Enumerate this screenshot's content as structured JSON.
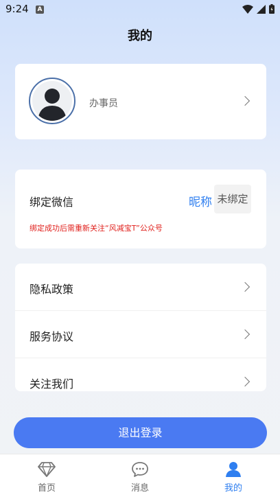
{
  "status_bar": {
    "time": "9:24",
    "notif_icon": "A"
  },
  "page": {
    "title": "我的"
  },
  "profile": {
    "name": "办事员"
  },
  "wechat": {
    "label": "绑定微信",
    "nickname": "昵称",
    "status": "未绑定",
    "notice": "绑定成功后需重新关注“风减宝T”公众号"
  },
  "menu": {
    "items": [
      {
        "label": "隐私政策"
      },
      {
        "label": "服务协议"
      },
      {
        "label": "关注我们"
      }
    ]
  },
  "logout_label": "退出登录",
  "tabbar": {
    "tabs": [
      {
        "label": "首页",
        "icon": "diamond-icon"
      },
      {
        "label": "消息",
        "icon": "chat-bubble-icon"
      },
      {
        "label": "我的",
        "icon": "person-icon"
      }
    ],
    "active_index": 2
  },
  "colors": {
    "accent": "#2f7ff0",
    "button": "#4a7af2",
    "notice": "#e0201c"
  }
}
